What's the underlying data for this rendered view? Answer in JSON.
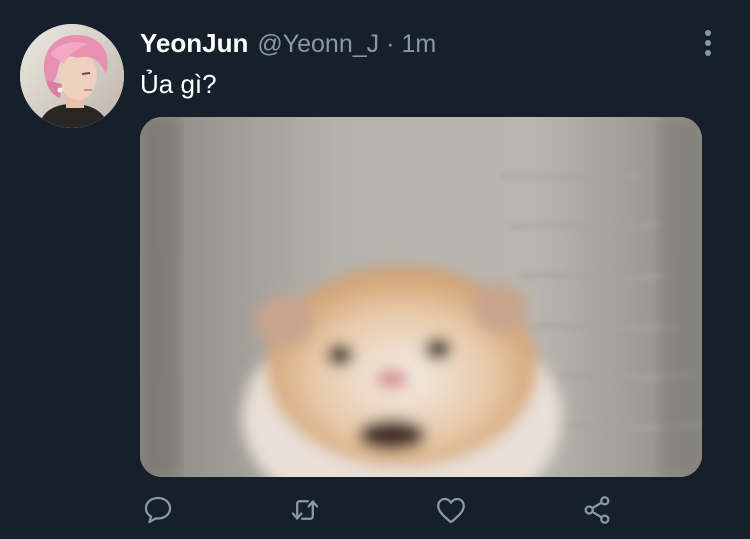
{
  "tweet": {
    "author": {
      "display_name": "YeonJun",
      "handle": "@Yeonn_J"
    },
    "separator": "·",
    "time": "1m",
    "text": "Ủa gì?",
    "media": {
      "icon": "hamster-photo"
    },
    "actions": [
      {
        "name": "reply",
        "icon": "comment-bubble-icon"
      },
      {
        "name": "retweet",
        "icon": "retweet-arrows-icon"
      },
      {
        "name": "like",
        "icon": "heart-icon"
      },
      {
        "name": "share",
        "icon": "share-nodes-icon"
      }
    ]
  },
  "colors": {
    "background": "#15202b",
    "primary_text": "#ffffff",
    "secondary_text": "#8899a6",
    "icon": "#8899a6"
  }
}
